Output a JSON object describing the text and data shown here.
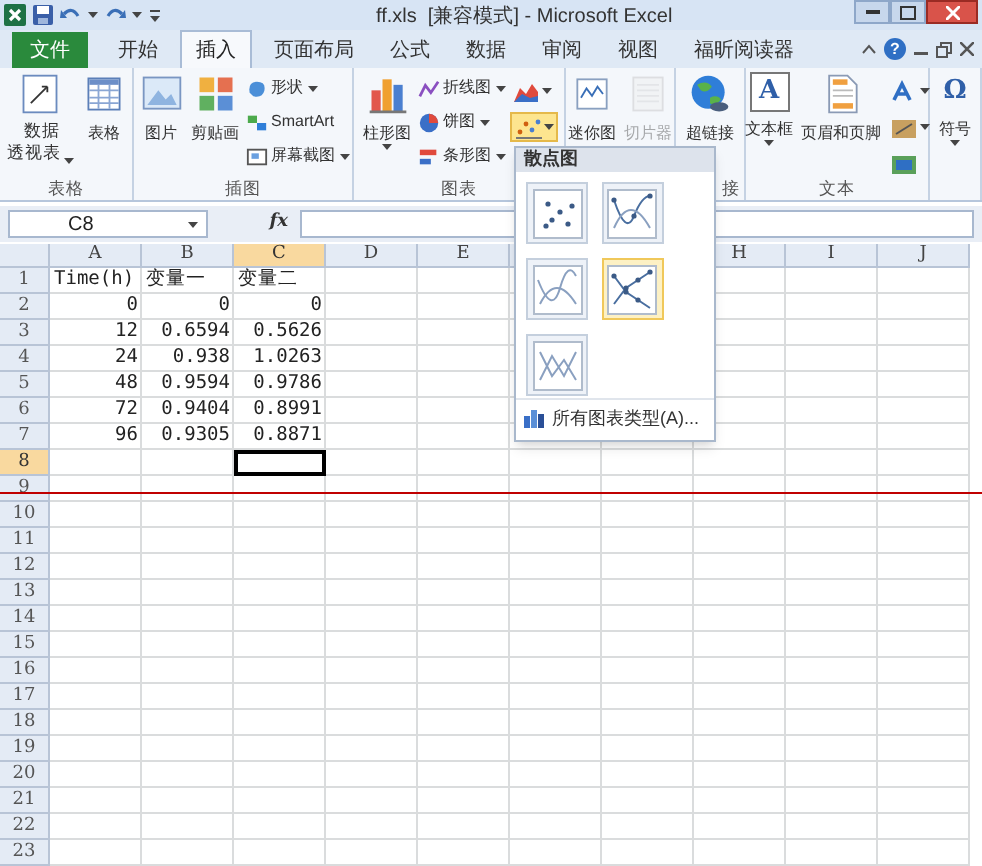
{
  "title_bar": {
    "title": "ff.xls  [兼容模式] - Microsoft Excel"
  },
  "tabs": [
    {
      "label": "文件",
      "selected": false,
      "kind": "file"
    },
    {
      "label": "开始",
      "selected": false,
      "kind": "tab"
    },
    {
      "label": "插入",
      "selected": true,
      "kind": "tab"
    },
    {
      "label": "页面布局",
      "selected": false,
      "kind": "tab"
    },
    {
      "label": "公式",
      "selected": false,
      "kind": "tab"
    },
    {
      "label": "数据",
      "selected": false,
      "kind": "tab"
    },
    {
      "label": "审阅",
      "selected": false,
      "kind": "tab"
    },
    {
      "label": "视图",
      "selected": false,
      "kind": "tab"
    },
    {
      "label": "福昕阅读器",
      "selected": false,
      "kind": "tab"
    }
  ],
  "help_glyph": "?",
  "ribbon": {
    "groups": [
      {
        "label": "表格",
        "items": [
          {
            "label": "数据透视表",
            "dropdown": true,
            "disabled": false
          },
          {
            "label": "表格",
            "dropdown": false,
            "disabled": false
          }
        ]
      },
      {
        "label": "插图",
        "items": [
          {
            "label": "图片",
            "dropdown": false,
            "disabled": false
          },
          {
            "label": "剪贴画",
            "dropdown": false,
            "disabled": false
          }
        ],
        "small_items": [
          {
            "label": "形状",
            "dropdown": true
          },
          {
            "label": "SmartArt",
            "dropdown": false
          },
          {
            "label": "屏幕截图",
            "dropdown": true
          }
        ]
      },
      {
        "label": "图表",
        "items": [
          {
            "label": "柱形图",
            "dropdown": true,
            "disabled": false
          }
        ],
        "small_items": [
          {
            "label": "折线图",
            "dropdown": true
          },
          {
            "label": "饼图",
            "dropdown": true
          },
          {
            "label": "条形图",
            "dropdown": true
          }
        ],
        "icon_buttons": [
          {
            "selected": false,
            "dropdown": true
          },
          {
            "selected": true,
            "dropdown": true
          }
        ]
      },
      {
        "items": [
          {
            "label": "迷你图",
            "dropdown": false,
            "disabled": false
          },
          {
            "label": "切片器",
            "dropdown": false,
            "disabled": true
          }
        ]
      },
      {
        "label": "接",
        "items": [
          {
            "label": "超链接",
            "dropdown": false,
            "disabled": false
          }
        ]
      },
      {
        "label": "文本",
        "items": [
          {
            "label": "文本框",
            "glyph": "A",
            "dropdown": true,
            "disabled": false
          },
          {
            "label": "页眉和页脚",
            "dropdown": false,
            "disabled": false
          }
        ],
        "icon_buttons": [
          {
            "selected": false,
            "dropdown": true
          },
          {
            "selected": false,
            "dropdown": true
          },
          {
            "selected": false,
            "dropdown": false
          }
        ]
      },
      {
        "items": [
          {
            "label": "符号",
            "glyph": "Ω",
            "dropdown": true,
            "disabled": false
          }
        ]
      }
    ]
  },
  "formula_bar": {
    "name_box": "C8",
    "function_label": "fx"
  },
  "sheet": {
    "columns": [
      {
        "label": "A",
        "selected": false
      },
      {
        "label": "B",
        "selected": false
      },
      {
        "label": "C",
        "selected": true
      },
      {
        "label": "D",
        "selected": false
      },
      {
        "label": "E",
        "selected": false
      },
      {
        "label": "H",
        "selected": false
      },
      {
        "label": "I",
        "selected": false
      },
      {
        "label": "J",
        "selected": false
      }
    ],
    "rows": [
      {
        "number": "1",
        "selected": false,
        "kind": "text",
        "cells": [
          "Time(h)",
          "变量一",
          "变量二"
        ]
      },
      {
        "number": "2",
        "selected": false,
        "kind": "number",
        "cells": [
          "0",
          "0",
          "0"
        ]
      },
      {
        "number": "3",
        "selected": false,
        "kind": "number",
        "cells": [
          "12",
          "0.6594",
          "0.5626"
        ]
      },
      {
        "number": "4",
        "selected": false,
        "kind": "number",
        "cells": [
          "24",
          "0.938",
          "1.0263"
        ]
      },
      {
        "number": "5",
        "selected": false,
        "kind": "number",
        "cells": [
          "48",
          "0.9594",
          "0.9786"
        ]
      },
      {
        "number": "6",
        "selected": false,
        "kind": "number",
        "cells": [
          "72",
          "0.9404",
          "0.8991"
        ]
      },
      {
        "number": "7",
        "selected": false,
        "kind": "number",
        "cells": [
          "96",
          "0.9305",
          "0.8871"
        ]
      },
      {
        "number": "8",
        "selected": true,
        "kind": "number",
        "cells": []
      },
      {
        "number": "9",
        "selected": false,
        "kind": "number",
        "cells": []
      },
      {
        "number": "10",
        "selected": false,
        "kind": "number",
        "cells": []
      },
      {
        "number": "11",
        "selected": false,
        "kind": "number",
        "cells": []
      },
      {
        "number": "12",
        "selected": false,
        "kind": "number",
        "cells": []
      },
      {
        "number": "13",
        "selected": false,
        "kind": "number",
        "cells": []
      },
      {
        "number": "14",
        "selected": false,
        "kind": "number",
        "cells": []
      },
      {
        "number": "15",
        "selected": false,
        "kind": "number",
        "cells": []
      },
      {
        "number": "16",
        "selected": false,
        "kind": "number",
        "cells": []
      },
      {
        "number": "17",
        "selected": false,
        "kind": "number",
        "cells": []
      },
      {
        "number": "18",
        "selected": false,
        "kind": "number",
        "cells": []
      },
      {
        "number": "19",
        "selected": false,
        "kind": "number",
        "cells": []
      },
      {
        "number": "20",
        "selected": false,
        "kind": "number",
        "cells": []
      },
      {
        "number": "21",
        "selected": false,
        "kind": "number",
        "cells": []
      },
      {
        "number": "22",
        "selected": false,
        "kind": "number",
        "cells": []
      },
      {
        "number": "23",
        "selected": false,
        "kind": "number",
        "cells": []
      }
    ]
  },
  "scatter_menu": {
    "title": "散点图",
    "options": [
      {
        "selected": false
      },
      {
        "selected": false
      },
      {
        "selected": false
      },
      {
        "selected": true
      },
      {
        "selected": false
      }
    ],
    "footer": "所有图表类型(A)..."
  }
}
